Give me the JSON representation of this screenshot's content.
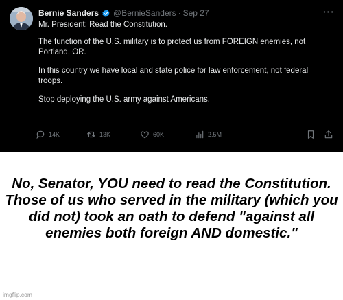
{
  "tweet": {
    "author_name": "Bernie Sanders",
    "author_handle": "@BernieSanders",
    "separator": "·",
    "date": "Sep 27",
    "more_icon": "more-icon",
    "paragraphs": [
      "Mr. President: Read the Constitution.",
      "The function of the U.S. military is to protect us from FOREIGN enemies, not Portland, OR.",
      "In this country we have local and state police for law enforcement, not federal troops.",
      "Stop deploying the U.S. army against Americans."
    ],
    "stats": {
      "replies": "14K",
      "retweets": "13K",
      "likes": "60K",
      "views": "2.5M"
    },
    "colors": {
      "background": "#000000",
      "text": "#e7e9ea",
      "muted": "#71767b",
      "verified": "#1d9bf0"
    }
  },
  "caption": "No, Senator, YOU need to read the Constitution.  Those of us who served in the military (which you did not) took an oath to defend \"against all enemies both foreign AND domestic.\"",
  "watermark": "imgflip.com"
}
